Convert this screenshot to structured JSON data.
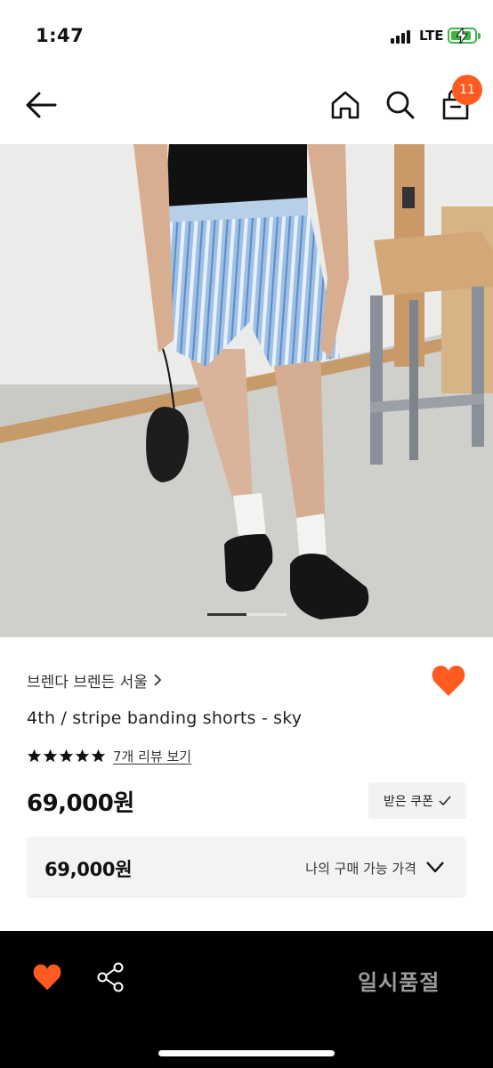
{
  "status_bar": {
    "time": "1:47",
    "network": "LTE"
  },
  "header": {
    "cart_count": "11"
  },
  "product": {
    "brand": "브렌다 브렌든 서울",
    "name": "4th / stripe banding shorts - sky",
    "rating": 5,
    "review_link": "7개 리뷰 보기",
    "price": "69,000원",
    "coupon_label": "받은 쿠폰",
    "my_price_value": "69,000원",
    "my_price_label": "나의 구매 가능 가격",
    "carousel": {
      "current": 1,
      "total": 2
    }
  },
  "bottom_bar": {
    "status": "일시품절"
  },
  "colors": {
    "accent": "#ff5a1f",
    "bottom_bar_bg": "#000000",
    "soldout_text": "#9a9a9a",
    "battery": "#3cb543"
  },
  "icons": [
    "back-arrow-icon",
    "home-icon",
    "search-icon",
    "shopping-bag-icon",
    "heart-icon",
    "share-icon",
    "star-icon",
    "chevron-right-icon",
    "chevron-down-icon",
    "check-icon"
  ]
}
